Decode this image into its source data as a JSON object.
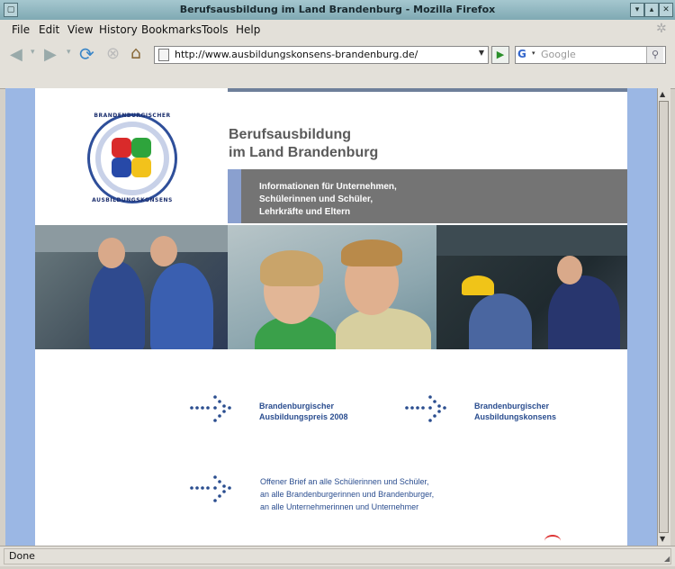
{
  "window": {
    "title": "Berufsausbildung im Land Brandenburg - Mozilla Firefox"
  },
  "menu": {
    "file": "File",
    "edit": "Edit",
    "view": "View",
    "history": "History",
    "bookmarks": "Bookmarks",
    "tools": "Tools",
    "help": "Help"
  },
  "nav": {
    "url": "http://www.ausbildungskonsens-brandenburg.de/",
    "search_placeholder": "Google",
    "search_engine_glyph": "G"
  },
  "page": {
    "heading_line1": "Berufsausbildung",
    "heading_line2": "im Land Brandenburg",
    "info_line1": "Informationen für Unternehmen,",
    "info_line2": "Schülerinnen und Schüler,",
    "info_line3": "Lehrkräfte und Eltern",
    "logo_top": "BRANDENBURGISCHER",
    "logo_bottom": "AUSBILDUNGSKONSENS",
    "link1_line1": "Brandenburgischer",
    "link1_line2": "Ausbildungspreis 2008",
    "link2_line1": "Brandenburgischer",
    "link2_line2": "Ausbildungskonsens",
    "open_letter_line1": "Offener Brief an alle Schülerinnen und Schüler,",
    "open_letter_line2": "an alle Brandenburgerinnen und Brandenburger,",
    "open_letter_line3": "an alle Unternehmerinnen und Unternehmer"
  },
  "status": {
    "text": "Done"
  },
  "colors": {
    "title_bg": "#7fa9b3",
    "chrome": "#e3e0d9",
    "page_side": "#9bb7e4",
    "info_box": "#747474",
    "link_text": "#2a4d8f"
  }
}
